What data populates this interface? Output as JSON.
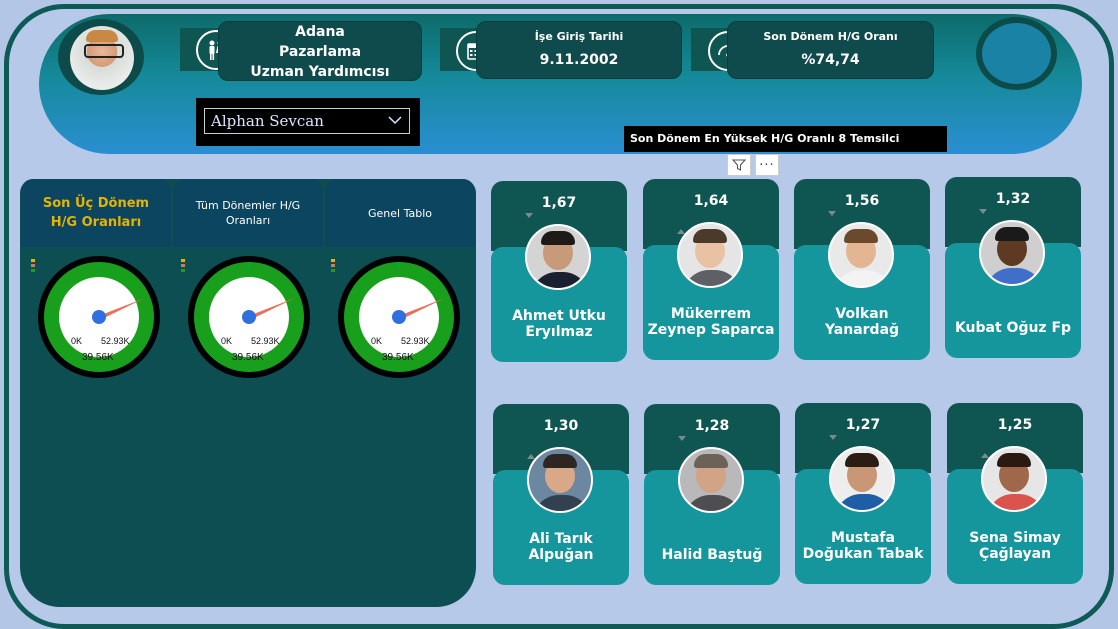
{
  "header": {
    "department": [
      "Adana",
      "Pazarlama",
      "Uzman Yardımcısı"
    ],
    "hire_date_label": "İşe Giriş Tarihi",
    "hire_date_value": "9.11.2002",
    "last_period_label": "Son Dönem H/G Oranı",
    "last_period_value": "%74,74",
    "icons": [
      "people-icon",
      "calendar-icon",
      "speedometer-icon"
    ]
  },
  "selector": {
    "value": "Alphan Sevcan"
  },
  "top8_title": "Son Dönem En Yüksek H/G Oranlı 8 Temsilci",
  "tabs": [
    {
      "label": "Son Üç Dönem H/G Oranları",
      "active": true
    },
    {
      "label": "Tüm Dönemler H/G Oranları",
      "active": false
    },
    {
      "label": "Genel Tablo",
      "active": false
    }
  ],
  "gauges": [
    {
      "min": "0K",
      "max": "52.93K",
      "value": "39.56K",
      "fraction": 0.75
    },
    {
      "min": "0K",
      "max": "52.93K",
      "value": "39.56K",
      "fraction": 0.75
    },
    {
      "min": "0K",
      "max": "52.93K",
      "value": "39.56K",
      "fraction": 0.75
    }
  ],
  "employees": [
    {
      "score": "1,67",
      "name": "Ahmet Utku Eryılmaz",
      "arrow": "down"
    },
    {
      "score": "1,64",
      "name": "Mükerrem Zeynep Saparca",
      "arrow": "up"
    },
    {
      "score": "1,56",
      "name": "Volkan Yanardağ",
      "arrow": "down"
    },
    {
      "score": "1,32",
      "name": "Kubat Oğuz Fp",
      "arrow": "down"
    },
    {
      "score": "1,30",
      "name": "Ali Tarık Alpuğan",
      "arrow": "up"
    },
    {
      "score": "1,28",
      "name": "Halid Baştuğ",
      "arrow": "down"
    },
    {
      "score": "1,27",
      "name": "Mustafa Doğukan Tabak",
      "arrow": "down"
    },
    {
      "score": "1,25",
      "name": "Sena Simay Çağlayan",
      "arrow": "up"
    }
  ],
  "colors": {
    "accent": "#e8b300",
    "gauge_green": "#18a01c",
    "needle": "#e87058",
    "card_teal": "#15969c",
    "dark_teal": "#0f5551"
  }
}
